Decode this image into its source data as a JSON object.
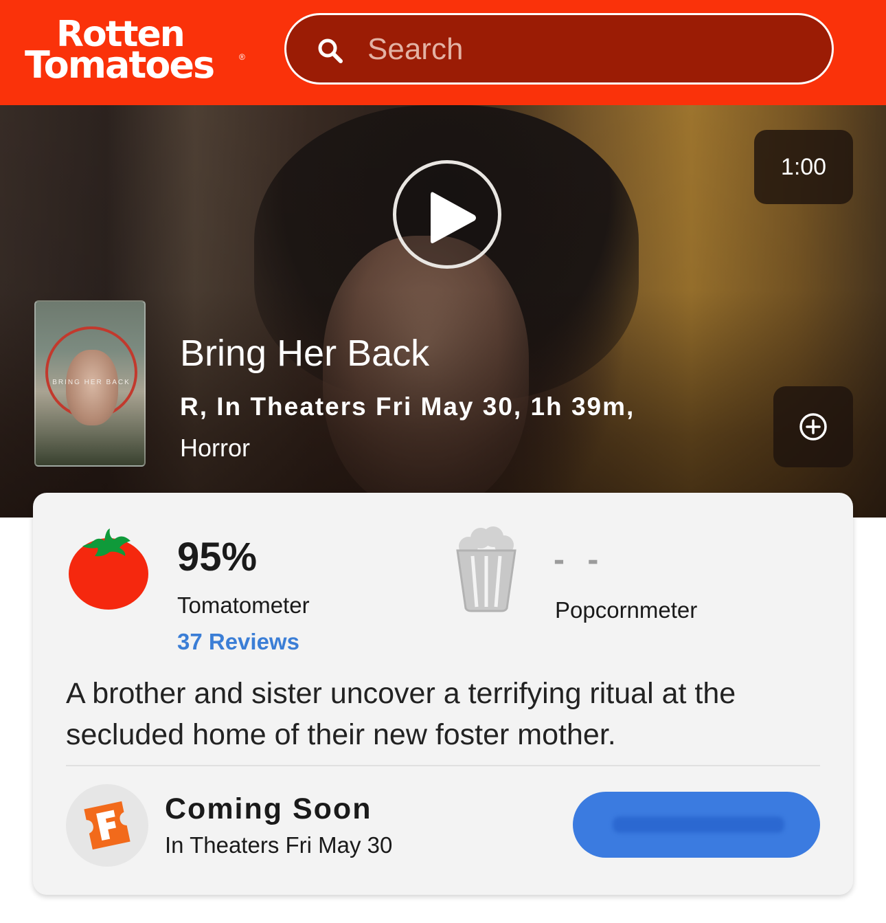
{
  "header": {
    "logo_line1": "Rotten",
    "logo_line2": "Tomatoes",
    "logo_reg": "®",
    "search_placeholder": "Search"
  },
  "hero": {
    "duration": "1:00",
    "poster_text": "BRING HER BACK",
    "title": "Bring Her Back",
    "meta": "R, In Theaters Fri May 30, 1h 39m,",
    "genre": "Horror"
  },
  "scores": {
    "tomatometer_value": "95%",
    "tomatometer_label": "Tomatometer",
    "reviews_link": "37 Reviews",
    "popcornmeter_value": "- -",
    "popcornmeter_label": "Popcornmeter"
  },
  "synopsis": "A brother and sister uncover a terrifying ritual at the secluded home of their new foster mother.",
  "showtimes": {
    "status": "Coming Soon",
    "date": "In Theaters Fri May 30"
  },
  "colors": {
    "brand_red": "#fa320a",
    "link_blue": "#3b7ed6",
    "button_blue": "#3b7be0",
    "tomato_red": "#f5280e",
    "fandango_orange": "#f26a1b"
  },
  "icons": {
    "search": "search-icon",
    "play": "play-icon",
    "add": "plus-circle-icon",
    "tomatometer": "fresh-tomato-icon",
    "popcornmeter": "empty-popcorn-bucket-icon",
    "fandango": "fandango-logo-icon"
  }
}
